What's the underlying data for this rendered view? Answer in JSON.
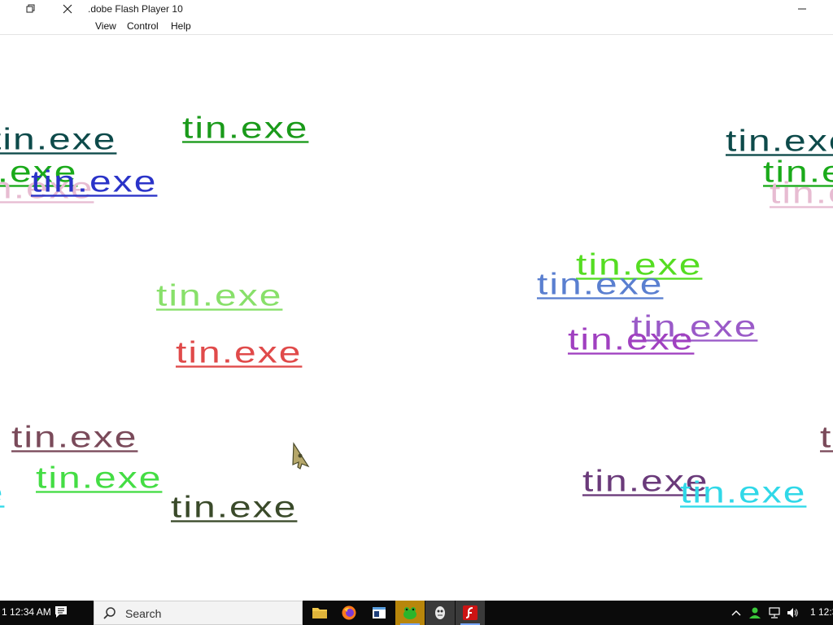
{
  "window": {
    "title": ".dobe Flash Player 10"
  },
  "menu": {
    "view": "View",
    "control": "Control",
    "help": "Help"
  },
  "stage": {
    "spam_text": "tin.exe",
    "spam_colors": [
      "#0d4a4a",
      "#1a9a1a",
      "#2a33c8",
      "#e7bcd2",
      "#5a8fe0",
      "#88e06a",
      "#e04a4a",
      "#a040c0",
      "#7a4a5a",
      "#44dd44",
      "#3a4a2a",
      "#66d4f0",
      "#6a3a7a",
      "#30d8e8",
      "#aac83a"
    ]
  },
  "taskbar": {
    "clock_left": "1 12:34 AM",
    "search_placeholder": "Search",
    "clock_right": "1 12:3",
    "apps": [
      "file-explorer",
      "firefox",
      "window-app",
      "green-creature-app",
      "sprite-app",
      "flash-player"
    ]
  }
}
